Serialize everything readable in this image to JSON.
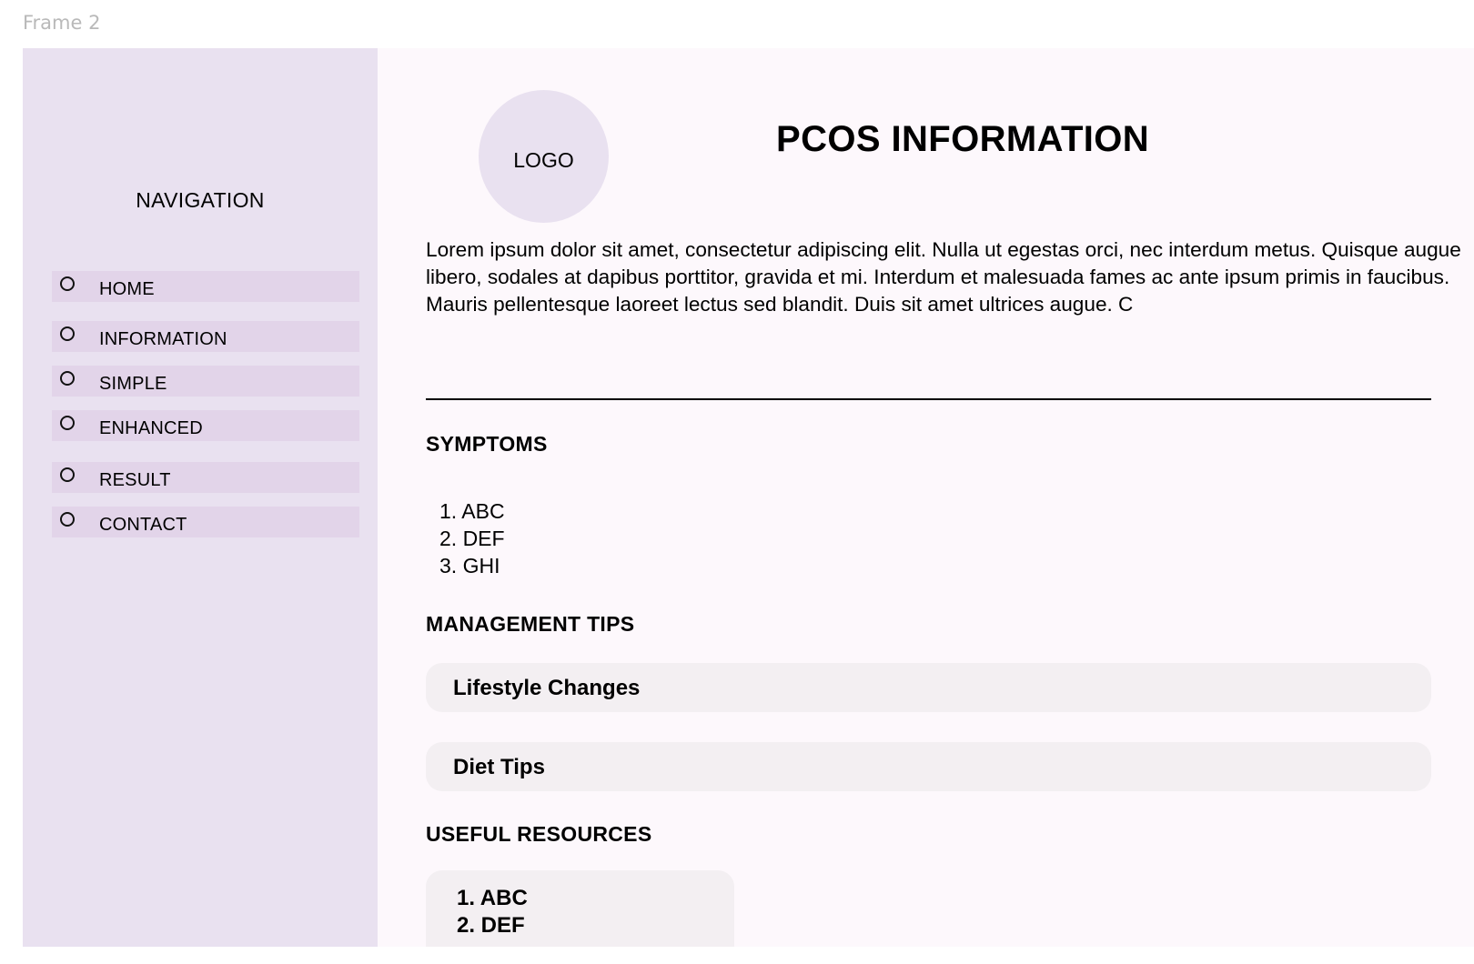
{
  "frame": {
    "label": "Frame 2"
  },
  "sidebar": {
    "title": "NAVIGATION",
    "items": [
      {
        "label": "HOME"
      },
      {
        "label": "INFORMATION"
      },
      {
        "label": "SIMPLE"
      },
      {
        "label": "ENHANCED"
      },
      {
        "label": "RESULT"
      },
      {
        "label": "CONTACT"
      }
    ]
  },
  "header": {
    "logo_text": "LOGO",
    "title": "PCOS INFORMATION"
  },
  "intro": {
    "text": "Lorem ipsum dolor sit amet, consectetur adipiscing elit. Nulla ut egestas orci, nec interdum metus. Quisque augue libero, sodales at dapibus porttitor, gravida et mi. Interdum et malesuada fames ac ante ipsum primis in faucibus. Mauris pellentesque laoreet lectus sed blandit. Duis sit amet ultrices augue. C"
  },
  "symptoms": {
    "heading": "SYMPTOMS",
    "items": [
      "1. ABC",
      "2. DEF",
      "3. GHI"
    ]
  },
  "management": {
    "heading": "MANAGEMENT TIPS",
    "sections": [
      {
        "label": "Lifestyle Changes"
      },
      {
        "label": "Diet Tips"
      }
    ]
  },
  "resources": {
    "heading": "USEFUL RESOURCES",
    "items": [
      "1. ABC",
      "2. DEF"
    ]
  },
  "colors": {
    "sidebar_bg": "#e9e1f0",
    "nav_item_bg": "#e2d4e9",
    "content_bg": "#fdf8fc",
    "card_bg": "#f3eff2"
  }
}
